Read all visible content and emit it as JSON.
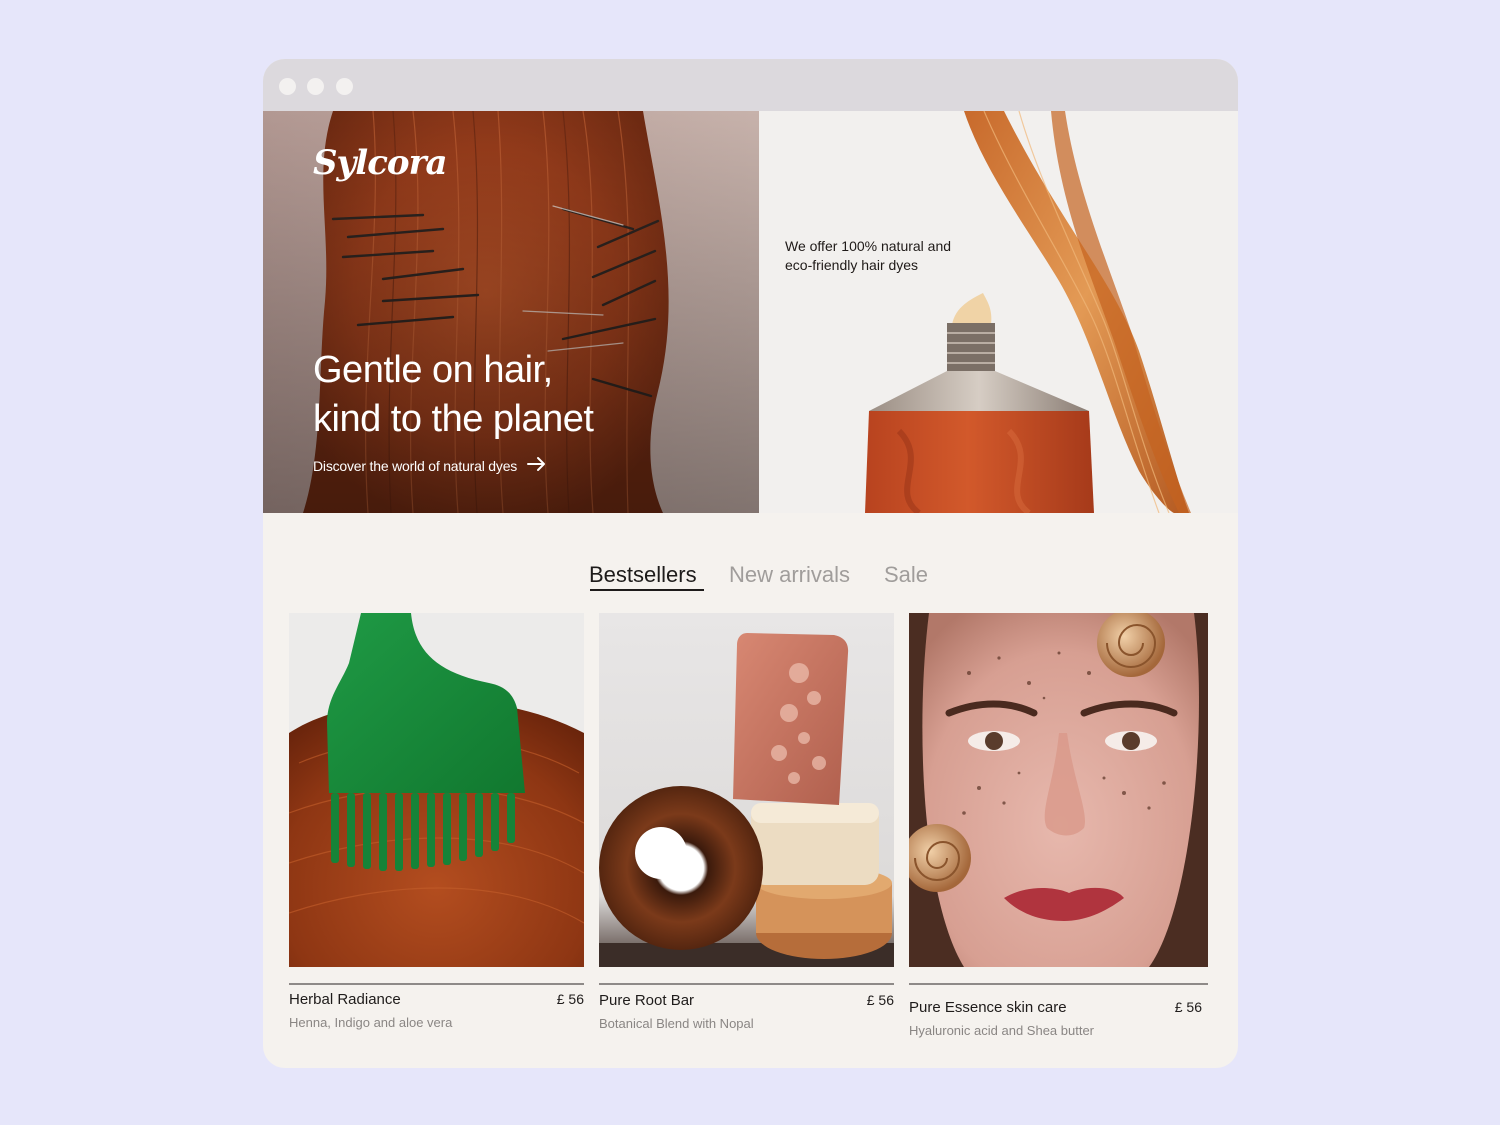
{
  "brand": {
    "logo": "Sylcora"
  },
  "hero": {
    "title_line1": "Gentle on hair,",
    "title_line2": "kind to the planet",
    "link_label": "Discover the world of natural dyes",
    "tagline": "We offer 100% natural and eco-friendly hair dyes"
  },
  "tabs": [
    {
      "label": "Bestsellers",
      "active": true
    },
    {
      "label": "New arrivals",
      "active": false
    },
    {
      "label": "Sale",
      "active": false
    }
  ],
  "products": [
    {
      "name": "Herbal Radiance",
      "price": "£ 56",
      "description": "Henna, Indigo and aloe vera"
    },
    {
      "name": "Pure Root Bar",
      "price": "£ 56",
      "description": "Botanical Blend with Nopal"
    },
    {
      "name": "Pure Essence skin care",
      "price": "£ 56",
      "description": "Hyaluronic acid and Shea butter"
    }
  ],
  "colors": {
    "page_background": "#e6e6fa",
    "window_background": "#f5f2ee",
    "titlebar": "#dcd9dd",
    "text_primary": "#1d1b1a",
    "text_muted": "#a09d9b"
  }
}
